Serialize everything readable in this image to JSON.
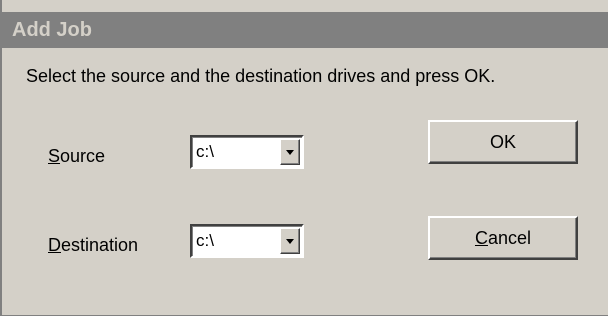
{
  "dialog": {
    "title": "Add Job",
    "instruction": "Select the source and the destination drives and press OK.",
    "source": {
      "label_mnemonic": "S",
      "label_rest": "ource",
      "value": "c:\\"
    },
    "destination": {
      "label_mnemonic": "D",
      "label_rest": "estination",
      "value": "c:\\"
    },
    "ok_label": "OK",
    "cancel": {
      "label_mnemonic": "C",
      "label_rest": "ancel"
    }
  },
  "colors": {
    "face": "#d4d0c8",
    "titlebar_inactive": "#808080"
  }
}
